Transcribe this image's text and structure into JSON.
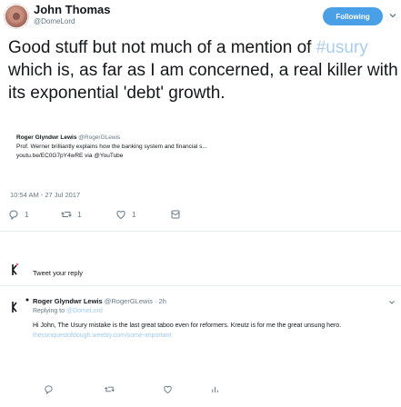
{
  "tweet": {
    "author_name": "John Thomas",
    "author_handle": "@DomeLord",
    "follow_label": "Following",
    "text_before": "Good stuff but not much of a mention of ",
    "hashtag": "#usury",
    "text_after": " which is, as far as I am concerned, a real killer with its exponential 'debt' growth.",
    "timestamp": "10:54 AM - 27 Jul 2017",
    "actions": {
      "replies": "1",
      "retweets": "1",
      "likes": "1"
    }
  },
  "quoted": {
    "author_name": "Roger Glyndwr Lewis",
    "author_handle": "@RogerGLewis",
    "line1": "Prof. Werner brilliantly explains how the banking system and financial s...",
    "line2": "youtu.be/EC0G7pY4wRE via @YouTube"
  },
  "composer": {
    "placeholder": "Tweet your reply"
  },
  "reply": {
    "author_name": "Roger Glyndwr Lewis",
    "author_handle": "@RogerGLewis",
    "time": "· 2h",
    "replying_label": "Replying to ",
    "replying_handle": "@DomeLord",
    "text": "Hi John, The Usury mistake is the last great taboo even for reformers.  Kreutz is for me the great unsung hero. ",
    "link": "theconquestofdough.weebly.com/some-important"
  },
  "colors": {
    "accent": "#4aa0e6",
    "hashtag": "#a9cdf0",
    "muted": "#657786",
    "link": "#9ccaf3"
  },
  "icons": [
    "reply-icon",
    "retweet-icon",
    "like-icon",
    "direct-message-icon",
    "analytics-icon",
    "chevron-down-icon"
  ]
}
